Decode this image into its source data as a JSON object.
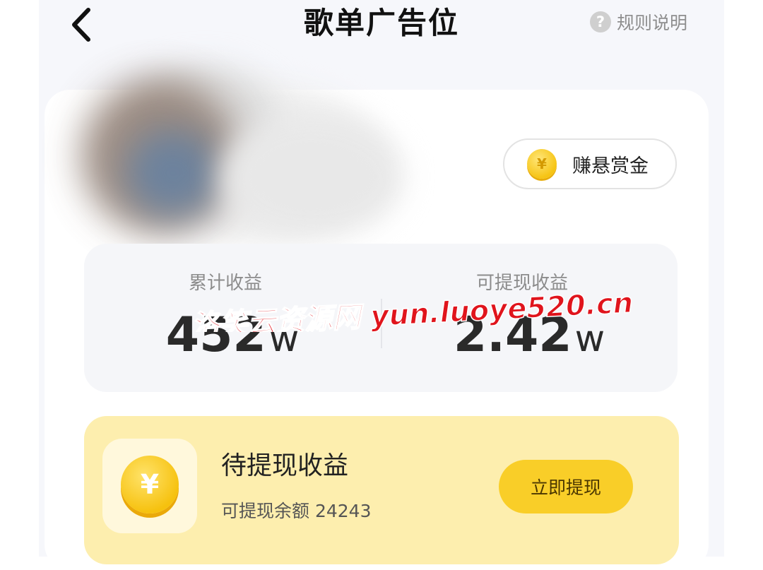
{
  "header": {
    "title": "歌单广告位",
    "rules_label": "规则说明",
    "rules_icon": "question-icon",
    "back_icon": "back-chevron-icon"
  },
  "bounty": {
    "label": "赚悬赏金",
    "icon": "coin-icon",
    "coin_symbol": "¥"
  },
  "stats": {
    "total": {
      "label": "累计收益",
      "value": "452",
      "unit": "w"
    },
    "withdrawable": {
      "label": "可提现收益",
      "value": "2.42",
      "unit": "w"
    }
  },
  "pending": {
    "title": "待提现收益",
    "balance_text": "可提现余额 24243",
    "button_label": "立即提现",
    "coin_symbol": "¥"
  },
  "watermark": {
    "text": "洛笑云资源网 yun.luoye520.cn",
    "color": "#e0141c"
  },
  "colors": {
    "accent_yellow": "#f9ce28",
    "pending_bg": "#fdeeae",
    "text_dark": "#222222",
    "text_muted": "#8c8c8c"
  }
}
